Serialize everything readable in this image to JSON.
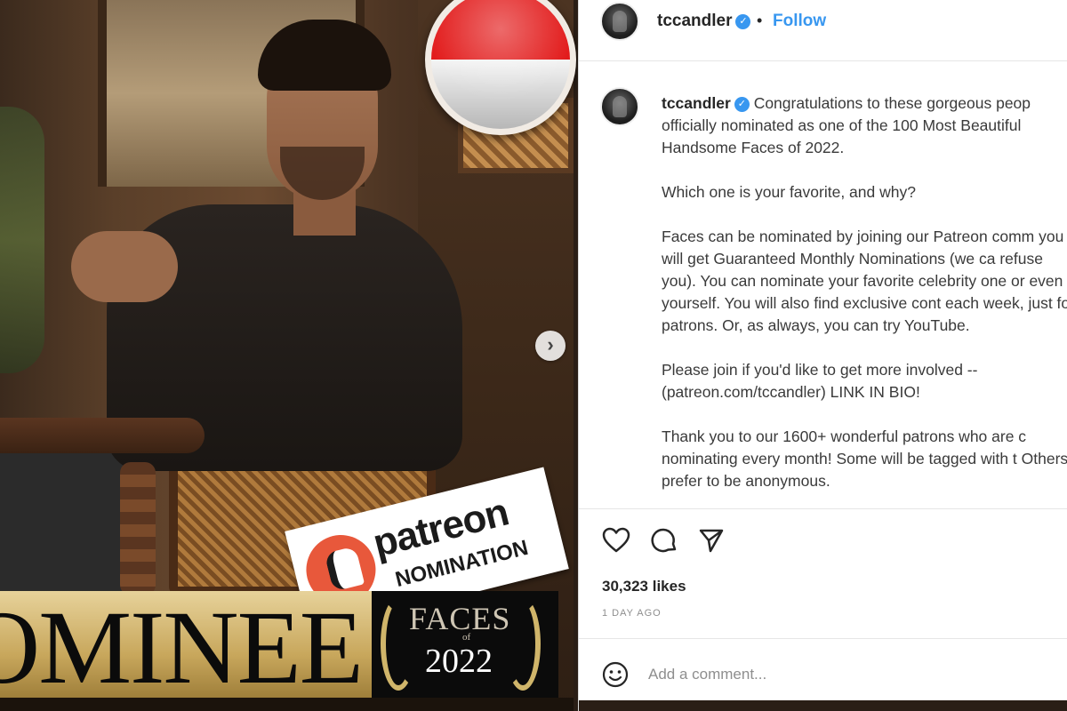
{
  "media": {
    "sticker_word": "patreon",
    "sticker_sub": "NOMINATION",
    "banner_text": "OMINEE",
    "faces_word": "FACES",
    "faces_of": "of",
    "faces_year": "2022",
    "flag_colors": [
      "#e21b1b",
      "#f4f4f4"
    ],
    "next_icon": "chevron-right-icon"
  },
  "post": {
    "username": "tccandler",
    "follow_label": "Follow",
    "caption_paragraphs": [
      "Congratulations to these gorgeous peop officially nominated as one of the 100 Most Beautiful Handsome Faces of 2022.",
      "Which one is your favorite, and why?",
      "Faces can be nominated by joining our Patreon comm you will get Guaranteed Monthly Nominations (we ca refuse you).  You can nominate your favorite celebrity one or even yourself.  You will also find exclusive cont each week, just for patrons.  Or, as always, you can try YouTube.",
      "Please join if you'd like to get more involved -- (patreon.com/tccandler) LINK IN BIO!",
      "Thank you to our 1600+ wonderful patrons who are c nominating every month!  Some will be tagged with t Others prefer to be anonymous."
    ],
    "likes": "30,323 likes",
    "time_ago": "1 DAY AGO",
    "comment_placeholder": "Add a comment...",
    "accent_color": "#3897f0"
  }
}
